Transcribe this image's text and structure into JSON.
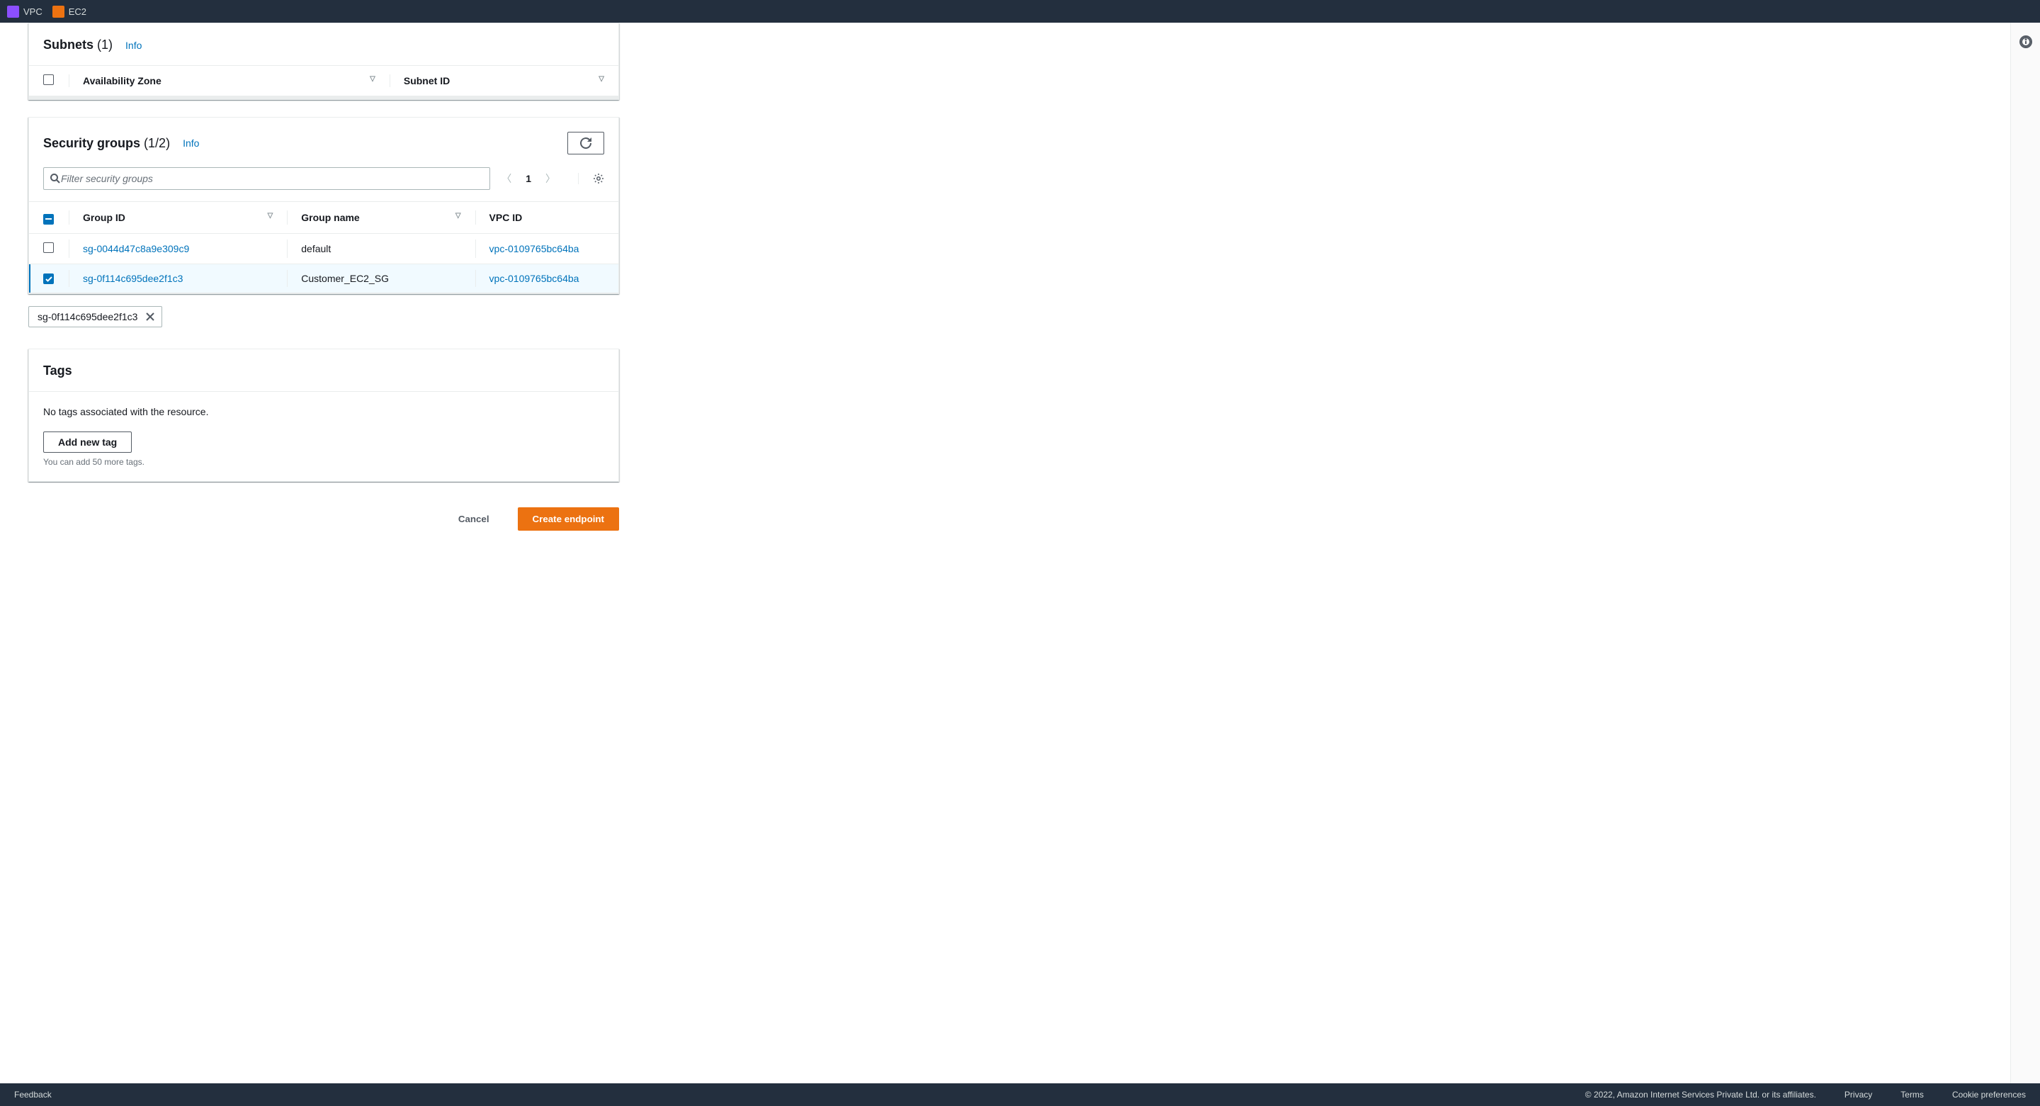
{
  "topbar": {
    "items": [
      {
        "label": "VPC",
        "icon": "vpc"
      },
      {
        "label": "EC2",
        "icon": "ec2"
      }
    ]
  },
  "subnets_panel": {
    "title": "Subnets",
    "count": "(1)",
    "info": "Info",
    "columns": {
      "az": "Availability Zone",
      "subnet_id": "Subnet ID"
    }
  },
  "sg_panel": {
    "title": "Security groups",
    "count": "(1/2)",
    "info": "Info",
    "search_placeholder": "Filter security groups",
    "page": "1",
    "columns": {
      "group_id": "Group ID",
      "group_name": "Group name",
      "vpc_id": "VPC ID"
    },
    "rows": [
      {
        "selected": false,
        "group_id": "sg-0044d47c8a9e309c9",
        "group_name": "default",
        "vpc_id": "vpc-0109765bc64ba"
      },
      {
        "selected": true,
        "group_id": "sg-0f114c695dee2f1c3",
        "group_name": "Customer_EC2_SG",
        "vpc_id": "vpc-0109765bc64ba"
      }
    ],
    "token": "sg-0f114c695dee2f1c3"
  },
  "tags_panel": {
    "title": "Tags",
    "empty_text": "No tags associated with the resource.",
    "add_button": "Add new tag",
    "hint": "You can add 50 more tags."
  },
  "actions": {
    "cancel": "Cancel",
    "create": "Create endpoint"
  },
  "footer": {
    "feedback": "Feedback",
    "copyright": "© 2022, Amazon Internet Services Private Ltd. or its affiliates.",
    "privacy": "Privacy",
    "terms": "Terms",
    "cookie": "Cookie preferences"
  }
}
